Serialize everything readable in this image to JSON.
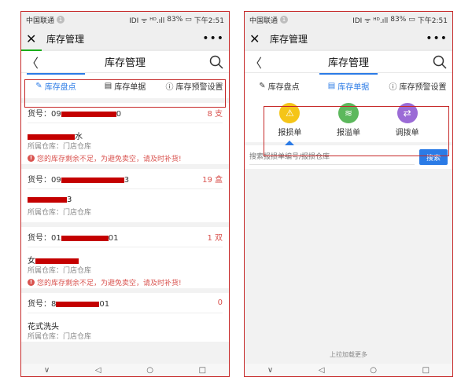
{
  "statusbar": {
    "carrier": "中国联通",
    "badge": "1",
    "signal": "ⅠDI ᯤ ᴴᴰ.ıll",
    "battery": "83%",
    "time": "下午2:51"
  },
  "wx_title": "库存管理",
  "nav_title": "库存管理",
  "tabs": [
    {
      "label": "库存盘点",
      "icon": "edit-icon"
    },
    {
      "label": "库存单据",
      "icon": "document-icon"
    },
    {
      "label": "库存预警设置",
      "icon": "help-circle-icon"
    }
  ],
  "left_list": [
    {
      "code_prefix": "货号：09",
      "code_suffix": "0",
      "qty": "8 支",
      "name_prefix": "",
      "name_suffix": "水",
      "warehouse": "所属仓库：门店仓库",
      "warning": "您的库存剩余不足，为避免卖空，请及时补货!"
    },
    {
      "code_prefix": "货号：09",
      "code_suffix": "3",
      "qty": "19 盒",
      "name_prefix": "",
      "name_suffix": "3",
      "warehouse": "所属仓库：门店仓库",
      "warning": ""
    },
    {
      "code_prefix": "货号：01",
      "code_suffix": "01",
      "qty": "1 双",
      "name_prefix": "女",
      "name_suffix": "",
      "warehouse": "所属仓库：门店仓库",
      "warning": "您的库存剩余不足，为避免卖空，请及时补货!"
    },
    {
      "code_prefix": "货号：8",
      "code_suffix": "01",
      "qty": "0",
      "name_prefix": "花式洗头",
      "name_suffix": "",
      "warehouse": "所属仓库：门店仓库",
      "warning": ""
    }
  ],
  "actions": [
    {
      "label": "报损单",
      "icon": "report-loss-icon",
      "color": "#f5c518",
      "glyph": "⚠"
    },
    {
      "label": "报溢单",
      "icon": "report-overflow-icon",
      "color": "#5cb85c",
      "glyph": "≋"
    },
    {
      "label": "调拨单",
      "icon": "transfer-icon",
      "color": "#9b6bd6",
      "glyph": "⇄"
    }
  ],
  "search": {
    "placeholder": "搜索报损单编号/报损仓库",
    "button": "搜索"
  },
  "pull_more": "上拉加载更多",
  "sysnav": {
    "down": "∨",
    "back": "◁",
    "home": "○",
    "recent": "□"
  },
  "colors": {
    "accent": "#2b7be6",
    "warning": "#d9534f",
    "highlight_border": "#c62828"
  }
}
